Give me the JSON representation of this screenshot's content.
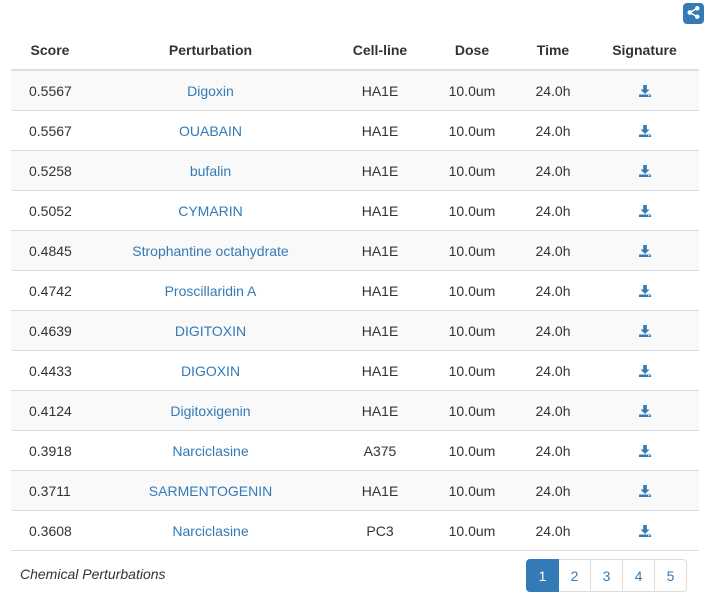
{
  "header": {
    "share_icon": "share-icon"
  },
  "table": {
    "columns": [
      "Score",
      "Perturbation",
      "Cell-line",
      "Dose",
      "Time",
      "Signature"
    ],
    "rows": [
      {
        "score": "0.5567",
        "perturbation": "Digoxin",
        "cell_line": "HA1E",
        "dose": "10.0um",
        "time": "24.0h",
        "signature_icon": "download-icon"
      },
      {
        "score": "0.5567",
        "perturbation": "OUABAIN",
        "cell_line": "HA1E",
        "dose": "10.0um",
        "time": "24.0h",
        "signature_icon": "download-icon"
      },
      {
        "score": "0.5258",
        "perturbation": "bufalin",
        "cell_line": "HA1E",
        "dose": "10.0um",
        "time": "24.0h",
        "signature_icon": "download-icon"
      },
      {
        "score": "0.5052",
        "perturbation": "CYMARIN",
        "cell_line": "HA1E",
        "dose": "10.0um",
        "time": "24.0h",
        "signature_icon": "download-icon"
      },
      {
        "score": "0.4845",
        "perturbation": "Strophantine octahydrate",
        "cell_line": "HA1E",
        "dose": "10.0um",
        "time": "24.0h",
        "signature_icon": "download-icon"
      },
      {
        "score": "0.4742",
        "perturbation": "Proscillaridin A",
        "cell_line": "HA1E",
        "dose": "10.0um",
        "time": "24.0h",
        "signature_icon": "download-icon"
      },
      {
        "score": "0.4639",
        "perturbation": "DIGITOXIN",
        "cell_line": "HA1E",
        "dose": "10.0um",
        "time": "24.0h",
        "signature_icon": "download-icon"
      },
      {
        "score": "0.4433",
        "perturbation": "DIGOXIN",
        "cell_line": "HA1E",
        "dose": "10.0um",
        "time": "24.0h",
        "signature_icon": "download-icon"
      },
      {
        "score": "0.4124",
        "perturbation": "Digitoxigenin",
        "cell_line": "HA1E",
        "dose": "10.0um",
        "time": "24.0h",
        "signature_icon": "download-icon"
      },
      {
        "score": "0.3918",
        "perturbation": "Narciclasine",
        "cell_line": "A375",
        "dose": "10.0um",
        "time": "24.0h",
        "signature_icon": "download-icon"
      },
      {
        "score": "0.3711",
        "perturbation": "SARMENTOGENIN",
        "cell_line": "HA1E",
        "dose": "10.0um",
        "time": "24.0h",
        "signature_icon": "download-icon"
      },
      {
        "score": "0.3608",
        "perturbation": "Narciclasine",
        "cell_line": "PC3",
        "dose": "10.0um",
        "time": "24.0h",
        "signature_icon": "download-icon"
      }
    ]
  },
  "footer": {
    "label": "Chemical Perturbations"
  },
  "pagination": {
    "pages": [
      "1",
      "2",
      "3",
      "4",
      "5"
    ],
    "active": "1"
  },
  "colors": {
    "link": "#337ab7",
    "active_page_bg": "#337ab7",
    "stripe": "#f9f9f9",
    "border": "#dddddd"
  }
}
